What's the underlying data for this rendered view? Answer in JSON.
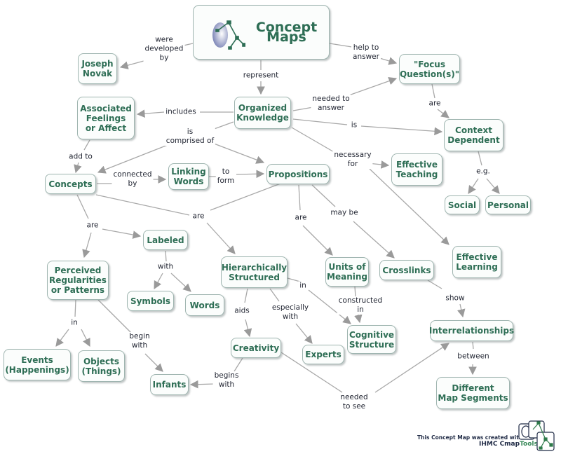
{
  "map_title": "Concept Maps",
  "colors": {
    "concept_text": "#2e6e55",
    "concept_border": "#9fb5b0",
    "link_line": "#a8a8a8",
    "arrow": "#9a9a9a",
    "linking_text": "#1f2330"
  },
  "concepts": {
    "concept_maps": "Concept Maps",
    "joseph_novak": "Joseph\nNovak",
    "focus_questions": "\"Focus\nQuestion(s)\"",
    "organized_knowledge": "Organized\nKnowledge",
    "associated_feelings": "Associated\nFeelings\nor Affect",
    "context_dependent": "Context\nDependent",
    "concepts": "Concepts",
    "linking_words": "Linking\nWords",
    "propositions": "Propositions",
    "effective_teaching": "Effective\nTeaching",
    "social": "Social",
    "personal": "Personal",
    "labeled": "Labeled",
    "effective_learning": "Effective\nLearning",
    "perceived_regularities": "Perceived\nRegularities\nor Patterns",
    "hierarchically_structured": "Hierarchically\nStructured",
    "units_of_meaning": "Units of\nMeaning",
    "crosslinks": "Crosslinks",
    "symbols": "Symbols",
    "words": "Words",
    "cognitive_structure": "Cognitive\nStructure",
    "interrelationships": "Interrelationships",
    "creativity": "Creativity",
    "experts": "Experts",
    "events": "Events\n(Happenings)",
    "objects": "Objects\n(Things)",
    "infants": "Infants",
    "different_map_segments": "Different\nMap Segments"
  },
  "linking_phrases": {
    "were_developed_by": "were\ndeveloped\nby",
    "help_to_answer": "help to\nanswer",
    "represent": "represent",
    "needed_to_answer": "needed to\nanswer",
    "includes": "includes",
    "is_context": "is",
    "are_focus": "are",
    "is_comprised_of": "is\ncomprised of",
    "necessary_for": "necessary\nfor",
    "add_to": "add to",
    "connected_by": "connected\nby",
    "to_form": "to\nform",
    "eg": "e.g.",
    "are_concepts": "are",
    "are_props": "are",
    "are_units": "are",
    "may_be": "may be",
    "with": "with",
    "in_perceived": "in",
    "aids": "aids",
    "especially_with": "especially\nwith",
    "in_hier": "in",
    "constructed_in": "constructed\nin",
    "show": "show",
    "begin_with": "begin\nwith",
    "between": "between",
    "begins_with": "begins\nwith",
    "needed_to_see": "needed\nto see"
  },
  "credit": {
    "line1": "This Concept Map was created with",
    "line2_a": "IHMC Cmap",
    "line2_b": "Tools"
  }
}
